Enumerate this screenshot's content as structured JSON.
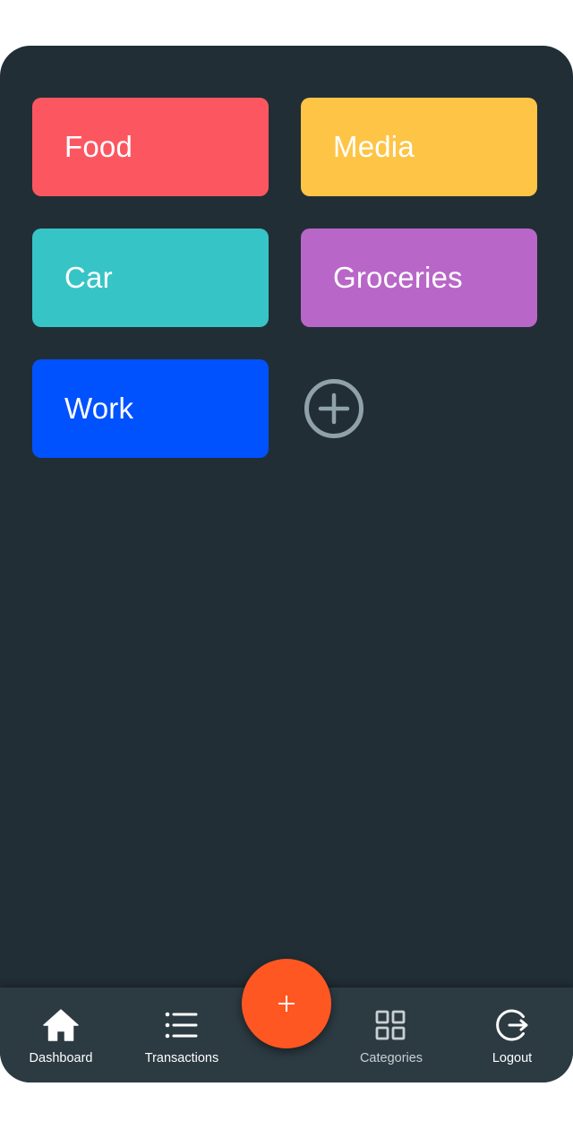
{
  "categories": [
    {
      "label": "Food",
      "color": "#fc5761"
    },
    {
      "label": "Media",
      "color": "#fec445"
    },
    {
      "label": "Car",
      "color": "#37c4c7"
    },
    {
      "label": "Groceries",
      "color": "#b866c8"
    },
    {
      "label": "Work",
      "color": "#0052ff"
    }
  ],
  "add_category": {
    "icon": "plus-circle-icon",
    "color": "#90a1aa"
  },
  "fab": {
    "icon": "plus-icon",
    "color": "#ff5722"
  },
  "nav": {
    "dashboard": {
      "label": "Dashboard",
      "icon": "home-icon"
    },
    "transactions": {
      "label": "Transactions",
      "icon": "list-icon"
    },
    "categories": {
      "label": "Categories",
      "icon": "grid-icon"
    },
    "logout": {
      "label": "Logout",
      "icon": "logout-icon"
    }
  },
  "colors": {
    "background": "#212e36",
    "nav_background": "#2c3a42"
  }
}
